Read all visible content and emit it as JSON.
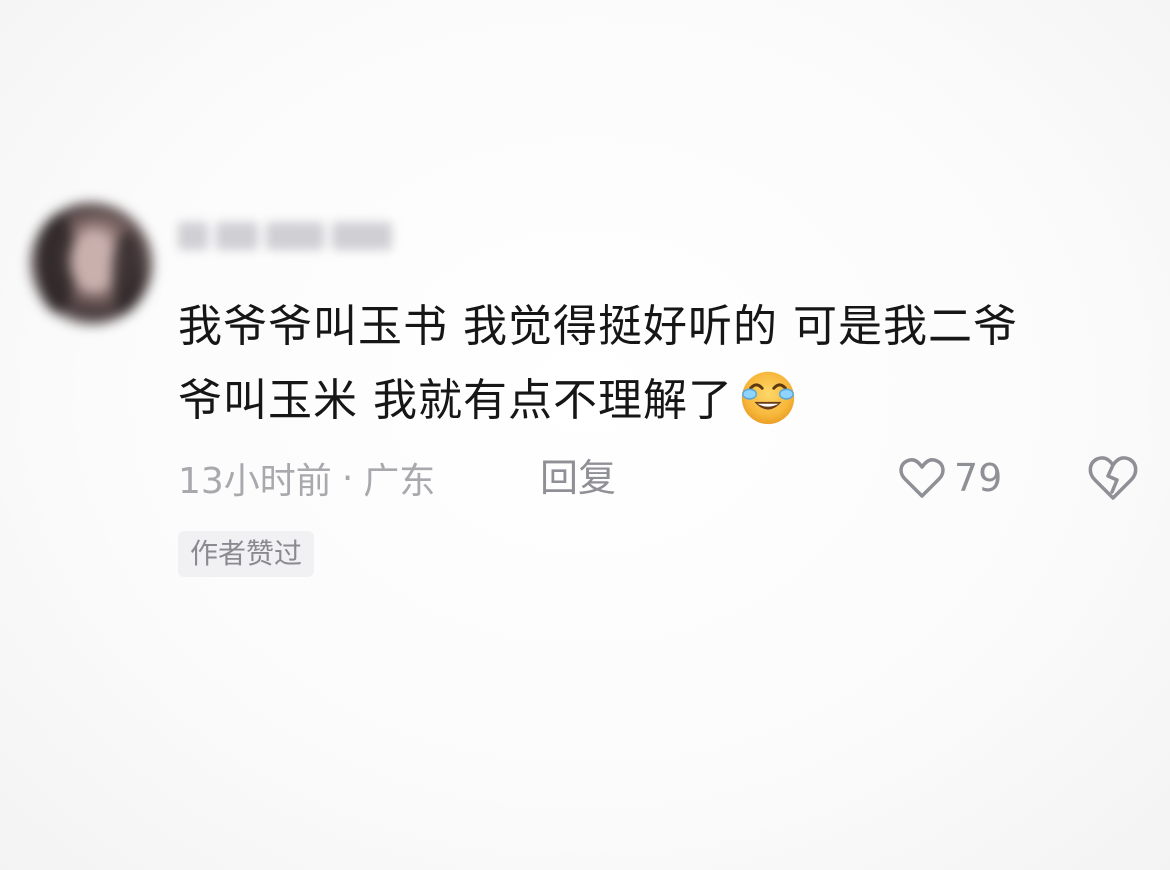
{
  "comment": {
    "username": "",
    "text_line1": "我爷爷叫玉书 我觉得挺好听的 可是我二爷",
    "text_line2": "爷叫玉米 我就有点不理解了",
    "emoji": "crying-laughing-emoji",
    "time": "13小时前",
    "separator": "·",
    "location": "广东",
    "reply_label": "回复",
    "like_count": "79",
    "author_badge": "作者赞过"
  },
  "icons": {
    "like": "heart-outline-icon",
    "dislike": "broken-heart-icon"
  },
  "colors": {
    "text": "#161616",
    "meta": "#a8a8ad",
    "icon": "#8f8f96",
    "emoji": "#f6b73c"
  }
}
